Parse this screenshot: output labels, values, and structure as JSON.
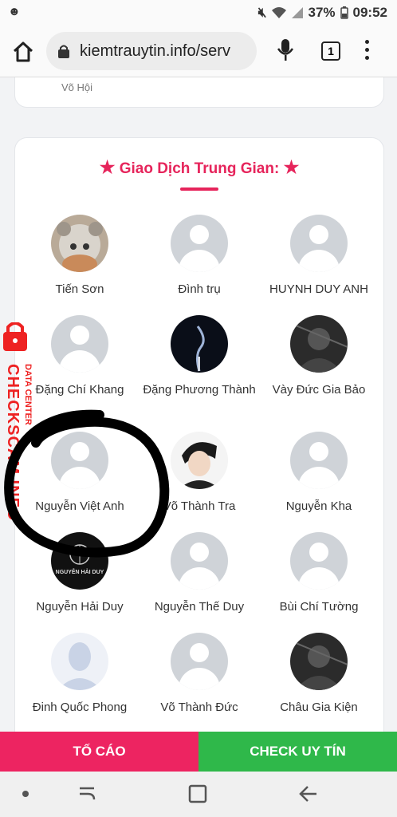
{
  "status": {
    "time": "09:52",
    "battery": "37%"
  },
  "browser": {
    "url": "kiemtrauytin.info/serv",
    "tab_count": "1"
  },
  "prev_card_text": "Võ Hội",
  "section": {
    "title": "Giao Dịch Trung Gian:"
  },
  "members": [
    {
      "name": "Tiến Sơn",
      "avatar": "cat"
    },
    {
      "name": "Đình trụ",
      "avatar": "default"
    },
    {
      "name": "HUYNH DUY ANH",
      "avatar": "default"
    },
    {
      "name": "Đặng Chí Khang",
      "avatar": "default"
    },
    {
      "name": "Đặng Phương Thành",
      "avatar": "dark-smoke"
    },
    {
      "name": "Vày Đức Gia Bảo",
      "avatar": "dark-photo"
    },
    {
      "name": "Nguyễn Việt Anh",
      "avatar": "default"
    },
    {
      "name": "Võ Thành Tra",
      "avatar": "anime"
    },
    {
      "name": "Nguyễn Kha",
      "avatar": "default"
    },
    {
      "name": "Nguyễn Hải Duy",
      "avatar": "logo"
    },
    {
      "name": "Nguyễn Thế Duy",
      "avatar": "default"
    },
    {
      "name": "Bùi Chí Tường",
      "avatar": "default"
    },
    {
      "name": "Đinh Quốc Phong",
      "avatar": "silhouette"
    },
    {
      "name": "Võ Thành Đức",
      "avatar": "default"
    },
    {
      "name": "Châu Gia Kiện",
      "avatar": "dark-photo"
    }
  ],
  "logo_avatar_text": "NGUYỄN HẢI DUY",
  "actions": {
    "report": "TỐ CÁO",
    "check": "CHECK UY TÍN"
  },
  "watermark": {
    "brand": "CHECKSCAM.INFO",
    "sub": "DATA CENTER"
  },
  "colors": {
    "accent": "#e6245b",
    "report": "#ed2461",
    "check": "#2fb84a"
  }
}
